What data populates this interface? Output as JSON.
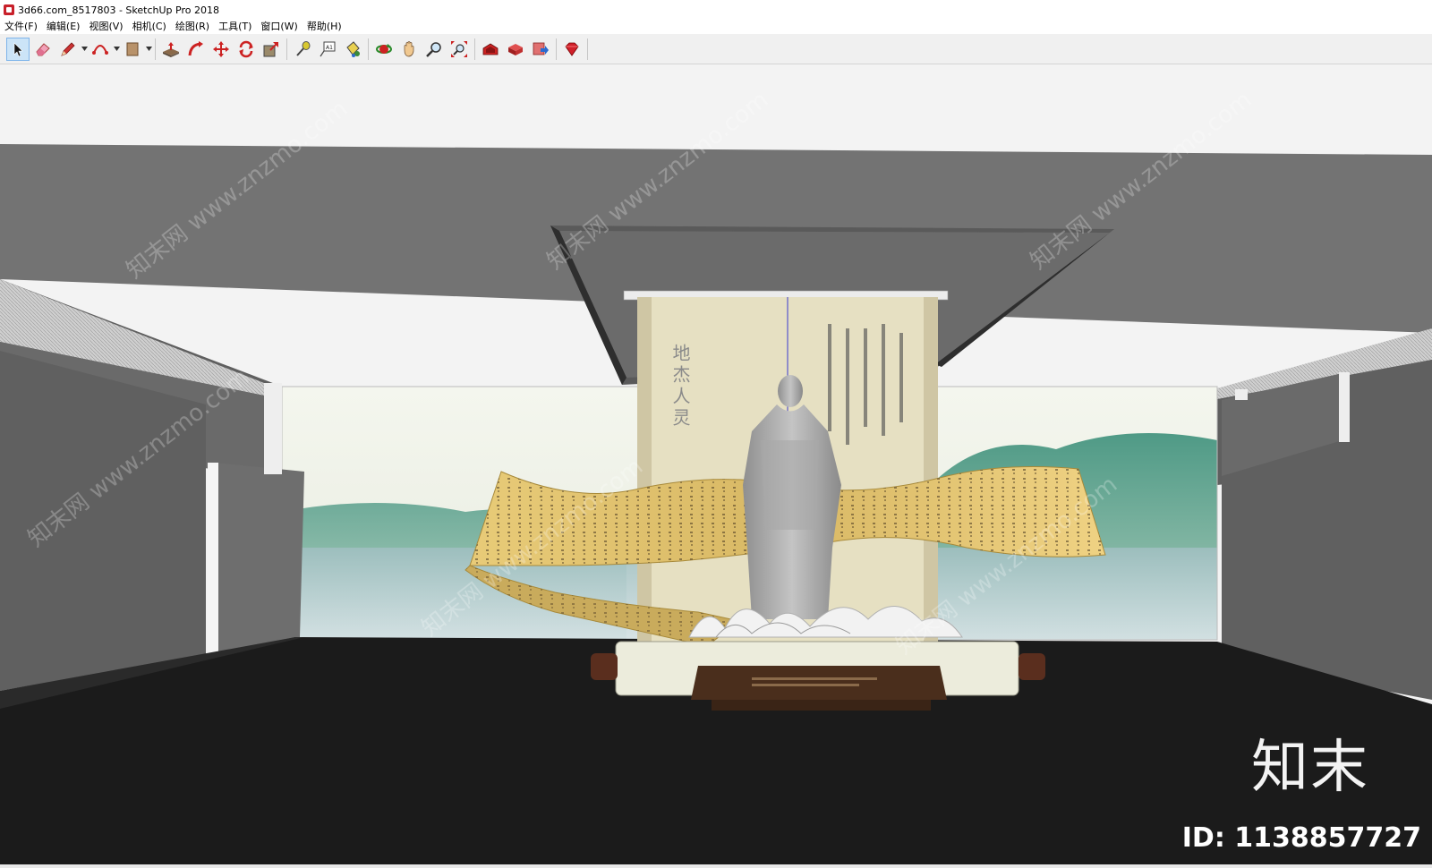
{
  "window": {
    "title": "3d66.com_8517803 - SketchUp Pro 2018"
  },
  "menu": [
    "文件(F)",
    "编辑(E)",
    "视图(V)",
    "相机(C)",
    "绘图(R)",
    "工具(T)",
    "窗口(W)",
    "帮助(H)"
  ],
  "toolbar": {
    "tools": [
      {
        "name": "select-icon",
        "active": true
      },
      {
        "name": "eraser-icon"
      },
      {
        "name": "pencil-icon"
      },
      {
        "name": "arc-icon"
      },
      {
        "name": "rectangle-icon"
      },
      {
        "name": "push-pull-icon"
      },
      {
        "name": "follow-me-icon"
      },
      {
        "name": "move-icon"
      },
      {
        "name": "rotate-icon"
      },
      {
        "name": "scale-icon"
      },
      {
        "name": "tape-measure-icon"
      },
      {
        "name": "text-icon"
      },
      {
        "name": "paint-bucket-icon"
      },
      {
        "name": "orbit-icon"
      },
      {
        "name": "pan-icon"
      },
      {
        "name": "zoom-icon"
      },
      {
        "name": "zoom-extents-icon"
      },
      {
        "name": "warehouse-icon"
      },
      {
        "name": "components-icon"
      },
      {
        "name": "share-model-icon"
      },
      {
        "name": "ruby-icon"
      }
    ]
  },
  "scene": {
    "scroll_title": "地杰人灵",
    "colors": {
      "ceiling": "#737373",
      "floor": "#1b1b1b",
      "scroll_paper": "#e6e0c2",
      "banner": "#d4b665"
    }
  },
  "watermarks": {
    "diagonal": "知末网 www.znzmo.com",
    "brand": "知末",
    "id": "ID: 1138857727"
  }
}
